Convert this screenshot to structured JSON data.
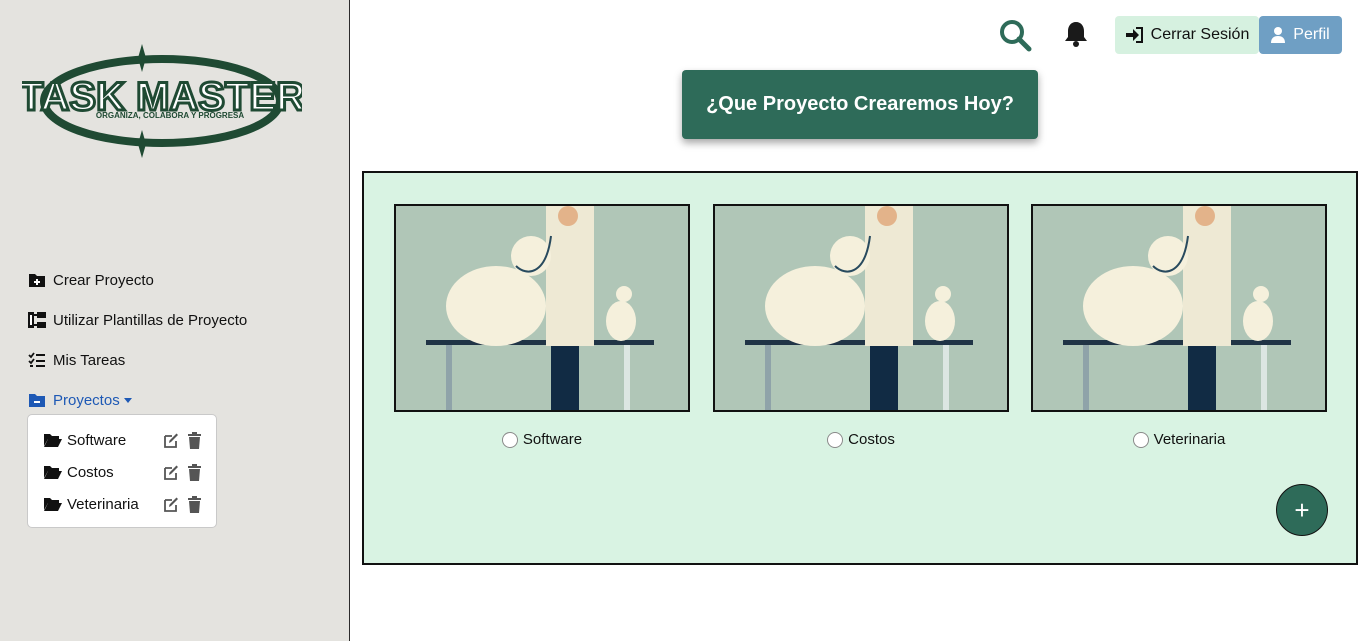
{
  "logo": {
    "title": "TASK MASTER",
    "tagline": "ORGANIZA, COLABORA Y PROGRESA"
  },
  "sidebar": {
    "nav": [
      {
        "label": "Crear Proyecto",
        "icon": "folder-plus-icon"
      },
      {
        "label": "Utilizar Plantillas de Proyecto",
        "icon": "sitemap-icon"
      },
      {
        "label": "Mis Tareas",
        "icon": "list-check-icon"
      },
      {
        "label": "Proyectos",
        "icon": "folder-minus-icon"
      }
    ],
    "projects": [
      {
        "name": "Software"
      },
      {
        "name": "Costos"
      },
      {
        "name": "Veterinaria"
      }
    ]
  },
  "header": {
    "logout_label": "Cerrar Sesión",
    "profile_label": "Perfil",
    "headline": "¿Que Proyecto Crearemos Hoy?"
  },
  "cards": [
    {
      "label": "Software"
    },
    {
      "label": "Costos"
    },
    {
      "label": "Veterinaria"
    }
  ],
  "fab_label": "+",
  "colors": {
    "accent": "#2e6b59",
    "panel": "#d9f3e3",
    "sidebar": "#e4e3df",
    "profile": "#6f9fc4",
    "active_link": "#1e59b5"
  }
}
